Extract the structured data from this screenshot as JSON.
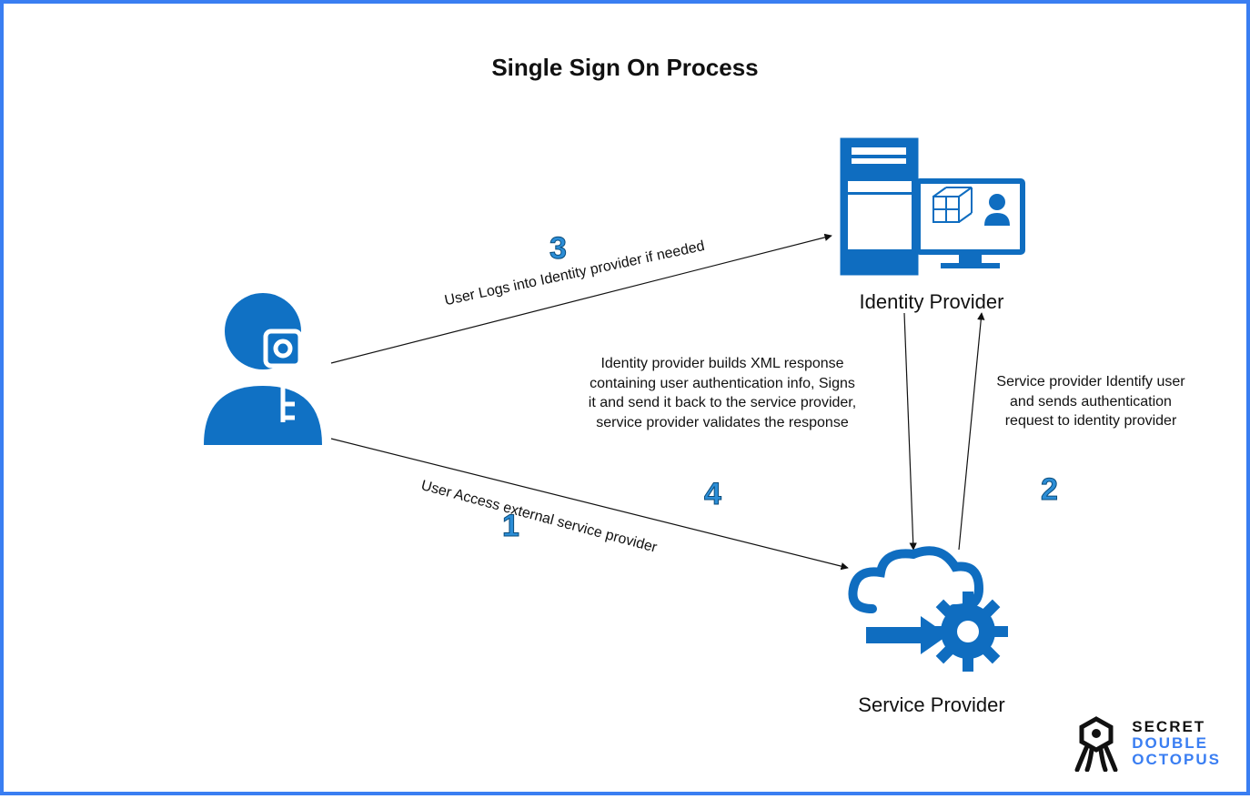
{
  "title": "Single Sign On Process",
  "nodes": {
    "user": {
      "label": ""
    },
    "idp": {
      "label": "Identity Provider"
    },
    "sp": {
      "label": "Service Provider"
    }
  },
  "steps": {
    "s1": {
      "num": "1",
      "text": "User Access external service provider"
    },
    "s2": {
      "num": "2",
      "text": "Service provider Identify user and sends authentication request to identity provider"
    },
    "s3": {
      "num": "3",
      "text": "User Logs into Identity provider if needed"
    },
    "s4": {
      "num": "4",
      "text": "Identity provider builds XML response containing user authentication info, Signs it and send it back to the service provider, service provider validates the response"
    }
  },
  "logo": {
    "line1": "SECRET",
    "line2": "DOUBLE",
    "line3": "OCTOPUS"
  }
}
